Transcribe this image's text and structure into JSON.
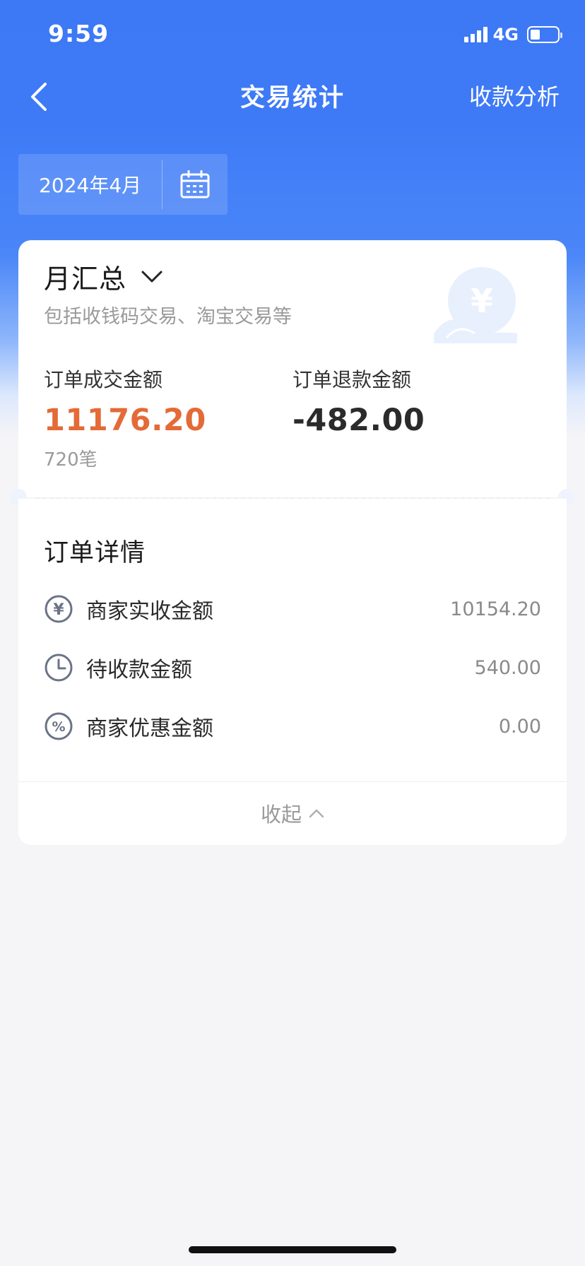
{
  "status_bar": {
    "time": "9:59",
    "network": "4G",
    "battery_level": 0.35
  },
  "nav": {
    "title": "交易统计",
    "action_label": "收款分析",
    "back_icon": "chevron-left-icon"
  },
  "month_picker": {
    "label": "2024年4月",
    "icon": "calendar-icon"
  },
  "summary": {
    "title": "月汇总",
    "dropdown_icon": "chevron-down-icon",
    "subtitle": "包括收钱码交易、淘宝交易等",
    "watermark_icon": "yuan-coin-icon",
    "order_amount": {
      "label": "订单成交金额",
      "value": "11176.20",
      "count": "720笔"
    },
    "refund_amount": {
      "label": "订单退款金额",
      "value": "-482.00"
    }
  },
  "details": {
    "title": "订单详情",
    "rows": [
      {
        "icon": "yuan-circle-icon",
        "label": "商家实收金额",
        "value": "10154.20"
      },
      {
        "icon": "clock-icon",
        "label": "待收款金额",
        "value": "540.00"
      },
      {
        "icon": "percent-circle-icon",
        "label": "商家优惠金额",
        "value": "0.00"
      }
    ],
    "collapse_label": "收起",
    "collapse_icon": "chevron-up-icon"
  },
  "colors": {
    "brand_blue": "#3d78f5",
    "amount_orange": "#e46a37",
    "icon_gray": "#6b7387"
  }
}
